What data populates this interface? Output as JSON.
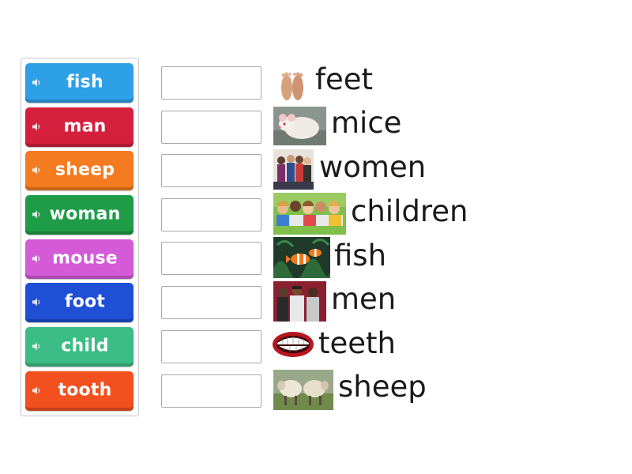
{
  "tiles": [
    {
      "label": "fish",
      "color": "#2ea0e8",
      "icon": "speaker-icon"
    },
    {
      "label": "man",
      "color": "#d4203d",
      "icon": "speaker-icon"
    },
    {
      "label": "sheep",
      "color": "#f47b20",
      "icon": "speaker-icon"
    },
    {
      "label": "woman",
      "color": "#1f9c48",
      "icon": "speaker-icon"
    },
    {
      "label": "mouse",
      "color": "#d45ad7",
      "icon": "speaker-icon"
    },
    {
      "label": "foot",
      "color": "#1f4fd4",
      "icon": "speaker-icon"
    },
    {
      "label": "child",
      "color": "#3cbc86",
      "icon": "speaker-icon"
    },
    {
      "label": "tooth",
      "color": "#f2501e",
      "icon": "speaker-icon"
    }
  ],
  "answers": [
    {
      "word": "feet",
      "picture": "bare-feet-image"
    },
    {
      "word": "mice",
      "picture": "white-mouse-image"
    },
    {
      "word": "women",
      "picture": "group-of-women-image"
    },
    {
      "word": "children",
      "picture": "group-of-children-image"
    },
    {
      "word": "fish",
      "picture": "clownfish-image"
    },
    {
      "word": "men",
      "picture": "group-of-men-image"
    },
    {
      "word": "teeth",
      "picture": "smiling-teeth-image"
    },
    {
      "word": "sheep",
      "picture": "sheep-image"
    }
  ]
}
